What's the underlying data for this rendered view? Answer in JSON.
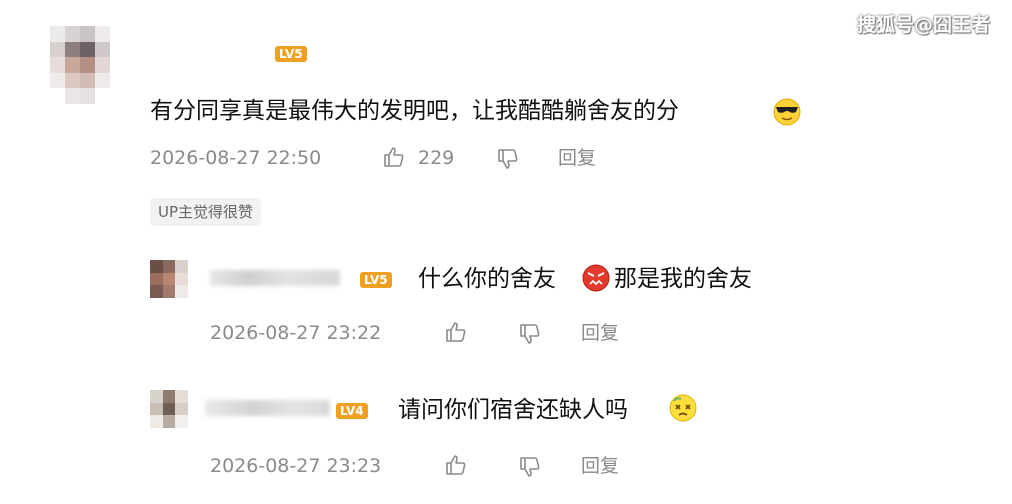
{
  "watermark": "搜狐号@囧王者",
  "main_comment": {
    "level_badge": "LV5",
    "text": "有分同享真是最伟大的发明吧，让我酷酷躺舍友的分",
    "emoji": "sunglasses-emoji",
    "timestamp": "2026-08-27 22:50",
    "like_count": "229",
    "reply_label": "回复",
    "up_liked_tag": "UP主觉得很赞"
  },
  "replies": [
    {
      "level_badge": "LV5",
      "text": "什么你的舍友",
      "emoji": "angry-emoji",
      "text_after": "那是我的舍友",
      "timestamp": "2026-08-27 23:22",
      "reply_label": "回复"
    },
    {
      "level_badge": "LV4",
      "text": "请问你们宿舍还缺人吗",
      "emoji": "dizzy-emoji",
      "timestamp": "2026-08-27 23:23",
      "reply_label": "回复"
    }
  ],
  "colors": {
    "badge": "#f0a020",
    "meta_text": "#8a8a8a",
    "tag_bg": "#f2f2f2"
  }
}
